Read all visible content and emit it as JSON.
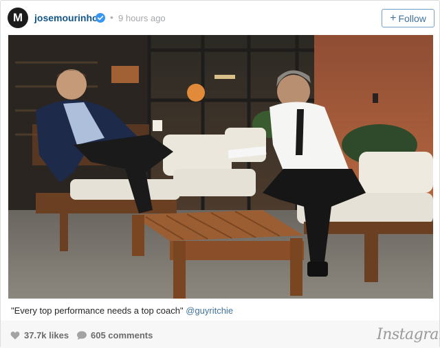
{
  "post": {
    "avatar_letter": "M",
    "username": "josemourinho",
    "separator": "•",
    "timestamp": "9 hours ago",
    "follow_label": "Follow",
    "caption_text": "\"Every top performance needs a top coach\" ",
    "caption_mention": "@guyritchie",
    "likes": "37.7k likes",
    "comments": "605 comments",
    "brand": "Instagram"
  },
  "colors": {
    "username": "#125688",
    "verified": "#3897f0",
    "follow_border": "#70a0c8",
    "follow_text": "#3f729b",
    "mention": "#3f729b",
    "footer_bg": "#f7f7f7"
  },
  "icons": {
    "verified": "verified-badge-icon",
    "follow": "plus-icon",
    "likes": "heart-icon",
    "comments": "speech-bubble-icon"
  }
}
